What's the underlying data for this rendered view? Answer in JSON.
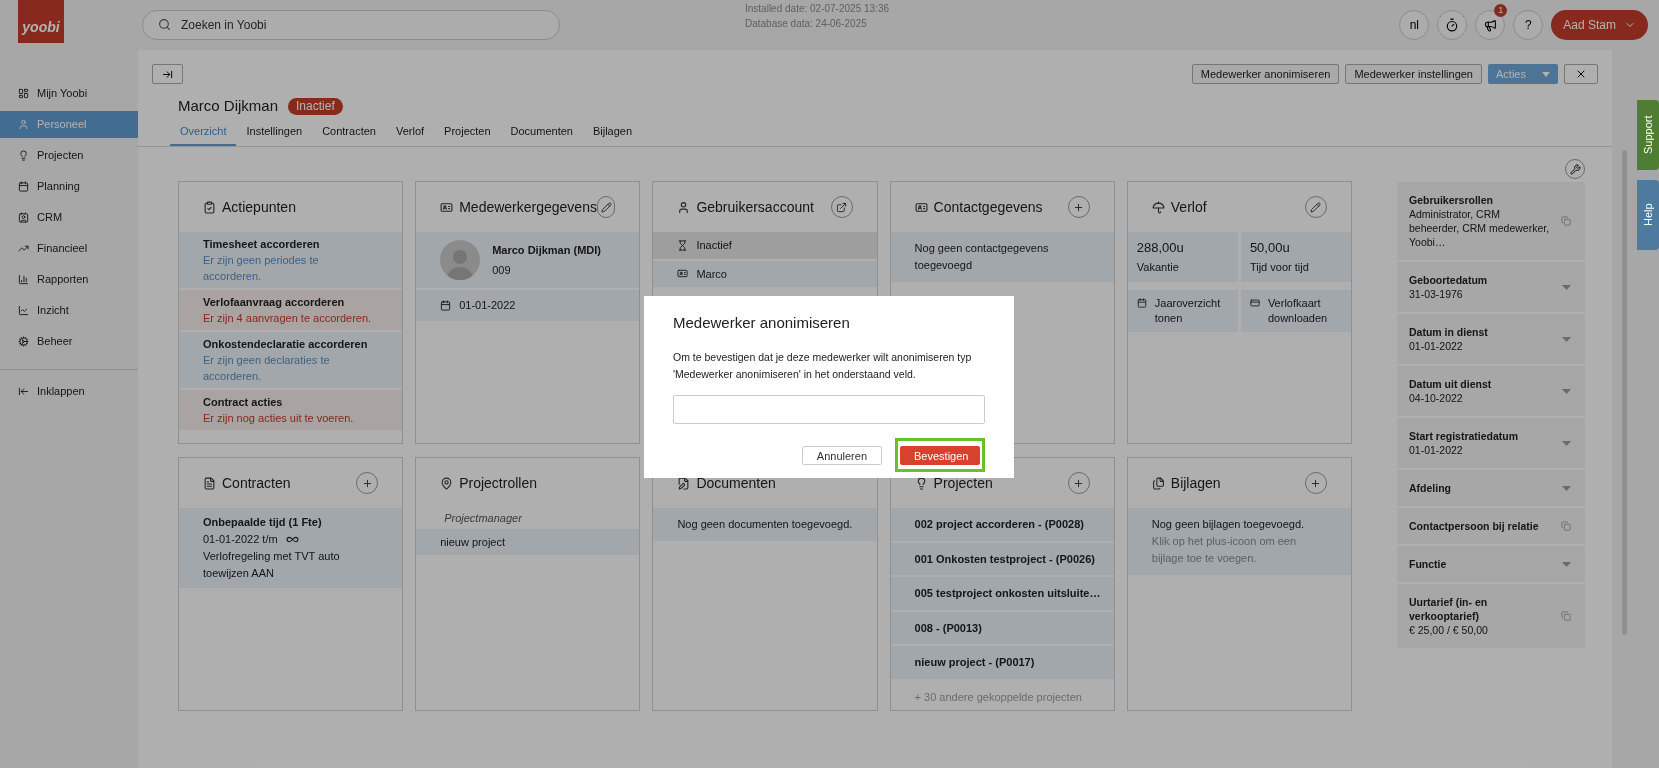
{
  "logo": "yoobi",
  "search": {
    "placeholder": "Zoeken in Yoobi"
  },
  "install_info": [
    "Installed date: 02-07-2025 13:36",
    "Database data: 24-06-2025"
  ],
  "header": {
    "language": "nl",
    "notification_count": "1",
    "help": "?",
    "user": "Aad Stam"
  },
  "sidebar": {
    "items": [
      {
        "label": "Mijn Yoobi",
        "selected": false
      },
      {
        "label": "Personeel",
        "selected": true
      },
      {
        "label": "Projecten",
        "selected": false
      },
      {
        "label": "Planning",
        "selected": false
      },
      {
        "label": "CRM",
        "selected": false
      },
      {
        "label": "Financieel",
        "selected": false
      },
      {
        "label": "Rapporten",
        "selected": false
      },
      {
        "label": "Inzicht",
        "selected": false
      },
      {
        "label": "Beheer",
        "selected": false
      }
    ],
    "collapse": "Inklappen"
  },
  "page": {
    "title": "Marco Dijkman",
    "status": "Inactief",
    "actions": [
      "Medewerker anonimiseren",
      "Medewerker instellingen"
    ],
    "menu": "Acties",
    "tabs": [
      {
        "label": "Overzicht",
        "selected": true
      },
      {
        "label": "Instellingen",
        "selected": false
      },
      {
        "label": "Contracten",
        "selected": false
      },
      {
        "label": "Verlof",
        "selected": false
      },
      {
        "label": "Projecten",
        "selected": false
      },
      {
        "label": "Documenten",
        "selected": false
      },
      {
        "label": "Bijlagen",
        "selected": false
      }
    ]
  },
  "cards": [
    {
      "kind": "actions",
      "title": "Actiepunten",
      "items": [
        {
          "title": "Timesheet accorderen",
          "text": "Er zijn geen periodes te accorderen.",
          "kind": "ok"
        },
        {
          "title": "Verlofaanvraag accorderen",
          "text": "Er zijn 4 aanvragen te accorderen.",
          "kind": "warning"
        },
        {
          "title": "Onkostendeclaratie accorderen",
          "text": "Er zijn geen declaraties te accorderen.",
          "kind": "ok"
        },
        {
          "title": "Contract acties",
          "text": "Er zijn nog acties uit te voeren.",
          "kind": "warning"
        }
      ]
    },
    {
      "kind": "employee",
      "title": "Medewerkergegevens",
      "name": "Marco Dijkman (MDI)",
      "number": "009",
      "date": "01-01-2022"
    },
    {
      "kind": "account",
      "title": "Gebruikersaccount",
      "rows": [
        "Inactief",
        "Marco"
      ]
    },
    {
      "kind": "contact",
      "title": "Contactgegevens",
      "text": "Nog geen contactgegevens toegevoegd"
    },
    {
      "kind": "leave",
      "title": "Verlof",
      "stats": [
        {
          "value": "288,00u",
          "label": "Vakantie"
        },
        {
          "value": "50,00u",
          "label": "Tijd voor tijd"
        }
      ],
      "links": [
        "Jaaroverzicht tonen",
        "Verlofkaart downloaden"
      ]
    },
    {
      "kind": "contracts",
      "title": "Contracten",
      "name": "Onbepaalde tijd (1 Fte)",
      "period": "01-01-2022 t/m",
      "lines": "Verlofregeling met TVT auto toewijzen AAN"
    },
    {
      "kind": "roles",
      "title": "Projectrollen",
      "role": "Projectmanager",
      "items": [
        "nieuw project"
      ]
    },
    {
      "kind": "documents",
      "title": "Documenten",
      "text": "Nog geen documenten toegevoegd."
    },
    {
      "kind": "projects",
      "title": "Projecten",
      "items": [
        "002 project accorderen - (P0028)",
        "001 Onkosten testproject - (P0026)",
        "005 testproject onkosten uitsluite…",
        "008 - (P0013)",
        "nieuw project - (P0017)"
      ],
      "more": "+ 30 andere gekoppelde projecten"
    },
    {
      "kind": "attachments",
      "title": "Bijlagen",
      "text": "Nog geen bijlagen toegevoegd.",
      "hint": "Klik op het plus-icoon om een bijlage toe te voegen."
    }
  ],
  "fields": [
    {
      "label": "Gebruikersrollen",
      "value": "Administrator, CRM beheerder, CRM medewerker, Yoobi…",
      "kind": "copy"
    },
    {
      "label": "Geboortedatum",
      "value": "31-03-1976",
      "kind": "dropdown"
    },
    {
      "label": "Datum in dienst",
      "value": "01-01-2022",
      "kind": "dropdown"
    },
    {
      "label": "Datum uit dienst",
      "value": "04-10-2022",
      "kind": "dropdown"
    },
    {
      "label": "Start registratiedatum",
      "value": "01-01-2022",
      "kind": "dropdown"
    },
    {
      "label": "Afdeling",
      "kind": "dropdown"
    },
    {
      "label": "Contactpersoon bij relatie",
      "kind": "copy"
    },
    {
      "label": "Functie",
      "kind": "dropdown"
    },
    {
      "label": "Uurtarief (in- en verkooptarief)",
      "value": "€ 25,00 / € 50,00",
      "kind": "copy"
    }
  ],
  "side_tabs": [
    {
      "label": "Support",
      "kind": "support"
    },
    {
      "label": "Help",
      "kind": "help"
    }
  ],
  "modal": {
    "title": "Medewerker anonimiseren",
    "text": "Om te bevestigen dat je deze medewerker wilt anonimiseren typ 'Medewerker anonimiseren' in het onderstaand veld.",
    "buttons": [
      {
        "label": "Annuleren",
        "kind": "secondary",
        "highlighted": false
      },
      {
        "label": "Bevestigen",
        "kind": "primary",
        "highlighted": true
      }
    ]
  }
}
